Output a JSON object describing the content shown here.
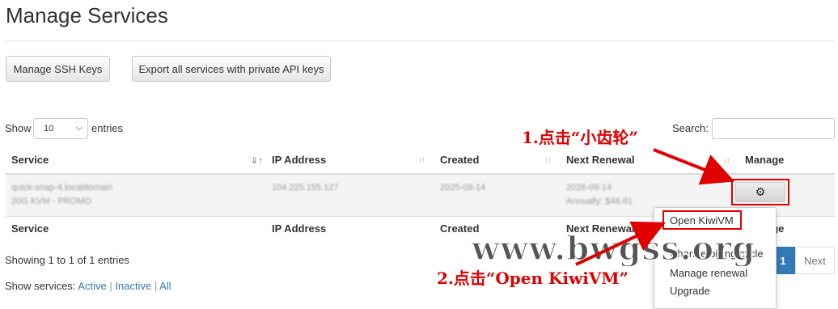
{
  "page": {
    "title": "Manage Services"
  },
  "toolbar": {
    "ssh_label": "Manage SSH Keys",
    "export_label": "Export all services with private API keys"
  },
  "table_controls": {
    "show_label": "Show",
    "entries_value": "10",
    "entries_label": "entries",
    "search_label": "Search:"
  },
  "table": {
    "headers": [
      "Service",
      "IP Address",
      "Created",
      "Next Renewal",
      "Manage"
    ],
    "rows": [
      {
        "service_line1": "quick-snap-4.localdomain",
        "service_line2": "20G KVM - PROMO",
        "ip": "104.225.155.127",
        "created": "2025-09-14",
        "renewal_date": "2026-09-14",
        "renewal_cycle": "Annually: $46.61"
      }
    ],
    "footer_headers": [
      "Service",
      "IP Address",
      "Created",
      "Next Renewal",
      "Manage"
    ]
  },
  "info": {
    "showing": "Showing 1 to 1 of 1 entries",
    "show_services_label": "Show services:",
    "filter_active": "Active",
    "filter_inactive": "Inactive",
    "filter_all": "All"
  },
  "pagination": {
    "current": "1",
    "next": "Next"
  },
  "dropdown": {
    "items": [
      "Open KiwiVM",
      "Change billing cycle",
      "Manage renewal",
      "Upgrade"
    ]
  },
  "annotations": {
    "step1": "1.点击“小齿轮”",
    "step2": "2.点击“Open KiwiVM”",
    "watermark": "www.bwgss.org"
  },
  "colors": {
    "annotation_red": "#e00000",
    "link_blue": "#337ab7",
    "pager_active": "#337ab7"
  }
}
